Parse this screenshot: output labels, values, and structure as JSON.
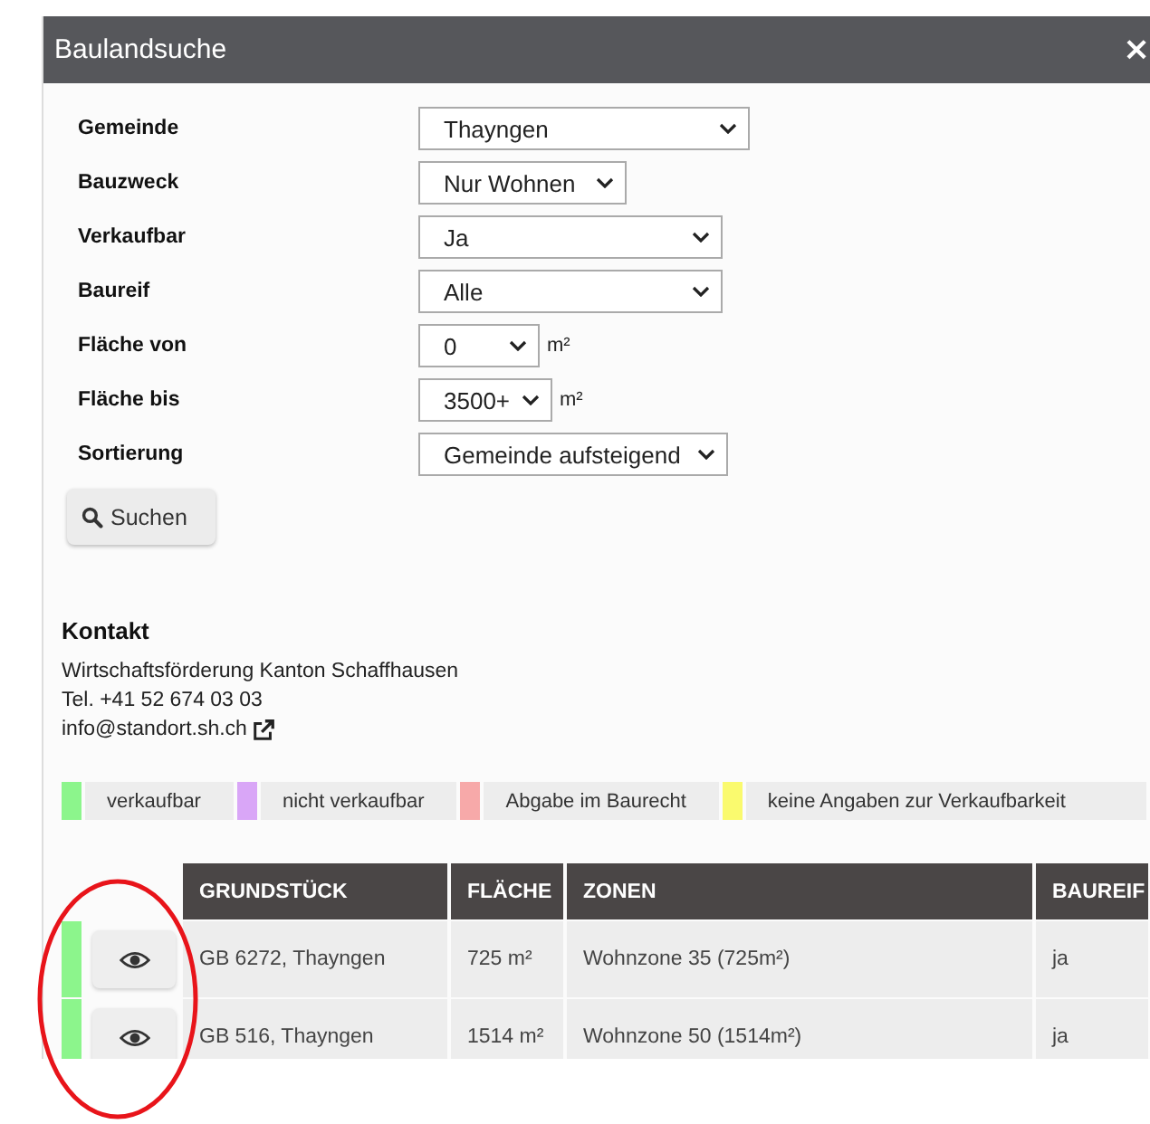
{
  "window": {
    "title": "Baulandsuche",
    "close": "×"
  },
  "form": {
    "fields": [
      {
        "label": "Gemeinde",
        "value": "Thayngen"
      },
      {
        "label": "Bauzweck",
        "value": "Nur Wohnen"
      },
      {
        "label": "Verkaufbar",
        "value": "Ja"
      },
      {
        "label": "Baureif",
        "value": "Alle"
      },
      {
        "label": "Fläche von",
        "value": "0",
        "unit": "m²"
      },
      {
        "label": "Fläche bis",
        "value": "3500+",
        "unit": "m²"
      },
      {
        "label": "Sortierung",
        "value": "Gemeinde aufsteigend"
      }
    ],
    "search_button": "Suchen"
  },
  "contact": {
    "heading": "Kontakt",
    "lines": [
      "Wirtschaftsförderung Kanton Schaffhausen",
      "Tel. +41 52 674 03 03"
    ],
    "email": "info@standort.sh.ch"
  },
  "legend": [
    {
      "label": "verkaufbar",
      "color": "#8cf58c"
    },
    {
      "label": "nicht verkaufbar",
      "color": "#d9a6f7"
    },
    {
      "label": "Abgabe im Baurecht",
      "color": "#f7a9a9"
    },
    {
      "label": "keine Angaben zur Verkaufbarkeit",
      "color": "#fafa6e"
    }
  ],
  "table": {
    "columns": [
      "GRUNDSTÜCK",
      "FLÄCHE",
      "ZONEN",
      "BAUREIF"
    ],
    "rows": [
      {
        "color": "#8cf58c",
        "cells": [
          "GB 6272, Thayngen",
          "725 m²",
          "Wohnzone 35 (725m²)",
          "ja"
        ]
      },
      {
        "color": "#8cf58c",
        "cells": [
          "GB 516, Thayngen",
          "1514 m²",
          "Wohnzone 50 (1514m²)",
          "ja"
        ]
      }
    ]
  },
  "annotation": {
    "kind": "ellipse"
  }
}
